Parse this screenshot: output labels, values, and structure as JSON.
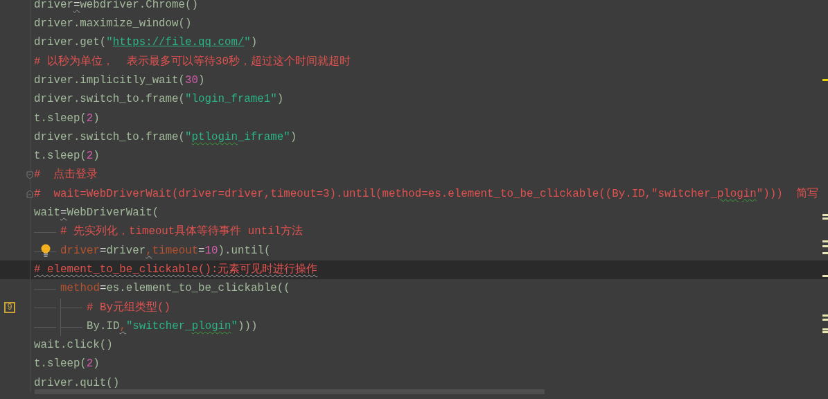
{
  "editor": {
    "lines": [
      {
        "tokens": [
          {
            "text": "driver",
            "kind": "plain"
          },
          {
            "text": "=",
            "kind": "op",
            "warning": true
          },
          {
            "text": "webdriver.Chrome()",
            "kind": "plain"
          }
        ]
      },
      {
        "tokens": [
          {
            "text": "driver.maximize_window()",
            "kind": "plain"
          }
        ]
      },
      {
        "tokens": [
          {
            "text": "driver.get(",
            "kind": "plain"
          },
          {
            "text": "\"",
            "kind": "string"
          },
          {
            "text": "https://file.qq.com/",
            "kind": "url"
          },
          {
            "text": "\"",
            "kind": "string"
          },
          {
            "text": ")",
            "kind": "plain"
          }
        ]
      },
      {
        "tokens": [
          {
            "text": "# 以秒为单位，  表示最多可以等待30秒，超过这个时间就超时",
            "kind": "comment"
          }
        ]
      },
      {
        "tokens": [
          {
            "text": "driver.implicitly_wait(",
            "kind": "plain"
          },
          {
            "text": "30",
            "kind": "number"
          },
          {
            "text": ")",
            "kind": "plain"
          }
        ]
      },
      {
        "tokens": [
          {
            "text": "driver.switch_to.frame(",
            "kind": "plain"
          },
          {
            "text": "\"login_frame1\"",
            "kind": "string"
          },
          {
            "text": ")",
            "kind": "plain"
          }
        ]
      },
      {
        "tokens": [
          {
            "text": "t.sleep(",
            "kind": "plain"
          },
          {
            "text": "2",
            "kind": "number"
          },
          {
            "text": ")",
            "kind": "plain"
          }
        ]
      },
      {
        "tokens": [
          {
            "text": "driver.switch_to.frame(",
            "kind": "plain"
          },
          {
            "text": "\"",
            "kind": "string"
          },
          {
            "text": "ptlogin",
            "kind": "string",
            "typo": true
          },
          {
            "text": "_iframe\"",
            "kind": "string"
          },
          {
            "text": ")",
            "kind": "plain"
          }
        ]
      },
      {
        "tokens": [
          {
            "text": "t.sleep(",
            "kind": "plain"
          },
          {
            "text": "2",
            "kind": "number"
          },
          {
            "text": ")",
            "kind": "plain"
          }
        ]
      },
      {
        "fold_start": true,
        "tokens": [
          {
            "text": "#  点击登录",
            "kind": "comment"
          }
        ]
      },
      {
        "fold_end": true,
        "tokens": [
          {
            "text": "#  wait=WebDriverWait(driver=driver,timeout=3).until(method=es.element_to_be_clickable((By.ID,\"switcher_",
            "kind": "comment"
          },
          {
            "text": "plogin",
            "kind": "comment",
            "typo": true
          },
          {
            "text": "\")))  简写",
            "kind": "comment"
          }
        ]
      },
      {
        "tokens": [
          {
            "text": "wait",
            "kind": "plain"
          },
          {
            "text": "=",
            "kind": "op",
            "warning": true
          },
          {
            "text": "WebDriverWait(",
            "kind": "plain"
          }
        ],
        "children": [
          {
            "tokens": [
              {
                "text": "# 先实列化，timeout具体等待事件 until方法",
                "kind": "comment"
              }
            ]
          },
          {
            "intention": true,
            "tokens": [
              {
                "text": "driver",
                "kind": "param"
              },
              {
                "text": "=",
                "kind": "op"
              },
              {
                "text": "driver",
                "kind": "plain"
              },
              {
                "text": ",",
                "kind": "param",
                "warning": true
              },
              {
                "text": "timeout",
                "kind": "param"
              },
              {
                "text": "=",
                "kind": "op"
              },
              {
                "text": "10",
                "kind": "number"
              },
              {
                "text": ").until(",
                "kind": "plain"
              }
            ]
          }
        ]
      },
      {
        "current": true,
        "tokens": [
          {
            "text": "# element_to_be_clickable():元素可见时进行操作",
            "kind": "comment",
            "warning": true
          }
        ]
      },
      {
        "children": [
          {
            "tokens": [
              {
                "text": "method",
                "kind": "param"
              },
              {
                "text": "=",
                "kind": "op"
              },
              {
                "text": "es.element_to_be_clickable((",
                "kind": "plain"
              }
            ],
            "children": [
              {
                "bookmark": "9",
                "tokens": [
                  {
                    "text": "# By元组类型()",
                    "kind": "comment"
                  }
                ]
              },
              {
                "tokens": [
                  {
                    "text": "By.ID",
                    "kind": "plain"
                  },
                  {
                    "text": ",",
                    "kind": "param",
                    "warning": true
                  },
                  {
                    "text": "\"switcher_",
                    "kind": "string"
                  },
                  {
                    "text": "plogin",
                    "kind": "string",
                    "typo": true
                  },
                  {
                    "text": "\"",
                    "kind": "string"
                  },
                  {
                    "text": ")))",
                    "kind": "plain"
                  }
                ]
              }
            ]
          }
        ]
      },
      {
        "tokens": [
          {
            "text": "wait.click()",
            "kind": "plain"
          }
        ]
      },
      {
        "tokens": [
          {
            "text": "t.sleep(",
            "kind": "plain"
          },
          {
            "text": "2",
            "kind": "number"
          },
          {
            "text": ")",
            "kind": "plain"
          }
        ]
      },
      {
        "tokens": [
          {
            "text": "driver.quit()",
            "kind": "plain"
          }
        ]
      }
    ]
  }
}
